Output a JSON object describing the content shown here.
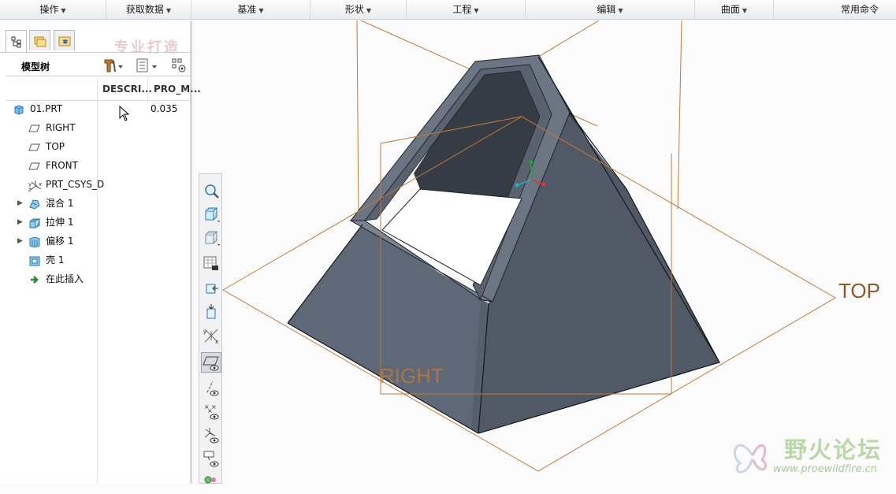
{
  "ribbon": {
    "groups": [
      "操作",
      "获取数据",
      "基准",
      "形状",
      "工程",
      "编辑",
      "曲面",
      "常用命令"
    ]
  },
  "model_tree": {
    "title": "模型树",
    "columns": [
      "DESCRI...",
      "PRO_M..."
    ],
    "items": [
      {
        "label": "01.PRT",
        "value": "0.035",
        "icon": "part-icon",
        "expandable": false
      },
      {
        "label": "RIGHT",
        "icon": "datum-plane-icon",
        "expandable": false
      },
      {
        "label": "TOP",
        "icon": "datum-plane-icon",
        "expandable": false
      },
      {
        "label": "FRONT",
        "icon": "datum-plane-icon",
        "expandable": false
      },
      {
        "label": "PRT_CSYS_D",
        "icon": "csys-icon",
        "expandable": false
      },
      {
        "label": "混合 1",
        "icon": "blend-icon",
        "expandable": true
      },
      {
        "label": "拉伸 1",
        "icon": "extrude-icon",
        "expandable": true
      },
      {
        "label": "偏移 1",
        "icon": "offset-icon",
        "expandable": true
      },
      {
        "label": "壳 1",
        "icon": "shell-icon",
        "expandable": false
      },
      {
        "label": "在此插入",
        "icon": "insert-here-icon",
        "expandable": false
      }
    ]
  },
  "watermark_top": "专业打造",
  "viewport": {
    "plane_labels": {
      "top": "TOP",
      "right": "RIGHT"
    },
    "colors": {
      "datum": "#c07a3a",
      "body_front": "#5d6877",
      "body_side": "#3d434b",
      "background": "#fbfbfb"
    }
  },
  "watermark": {
    "name": "野火论坛",
    "url": "www.proewildfire.cn"
  }
}
